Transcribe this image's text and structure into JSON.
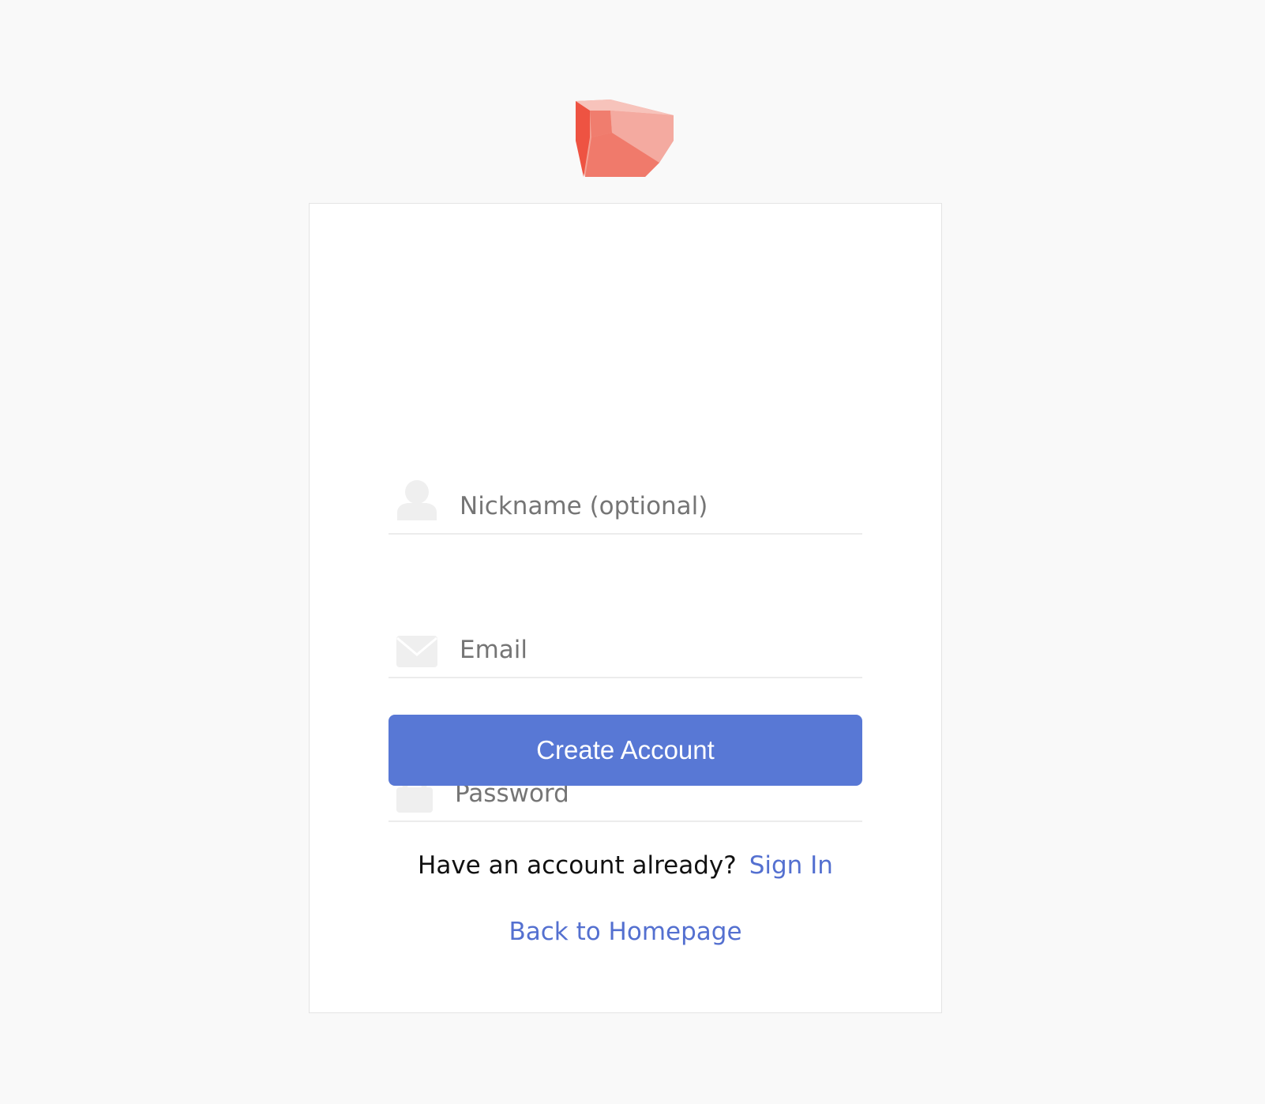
{
  "logo": {
    "icon": "ruby-gem-logo-icon"
  },
  "form": {
    "nickname": {
      "placeholder": "Nickname (optional)",
      "value": "",
      "icon": "user-icon"
    },
    "email": {
      "placeholder": "Email",
      "value": "",
      "icon": "envelope-icon"
    },
    "password": {
      "placeholder": "Password",
      "value": "",
      "icon": "lock-icon"
    },
    "submit_label": "Create Account"
  },
  "footer": {
    "have_account_text": "Have an account already?",
    "sign_in_label": "Sign In",
    "back_home_label": "Back to Homepage"
  },
  "colors": {
    "background": "#f9f9f9",
    "card": "#ffffff",
    "primary": "#5878d5",
    "link": "#5470d0",
    "logo": "#ef6a5a"
  }
}
